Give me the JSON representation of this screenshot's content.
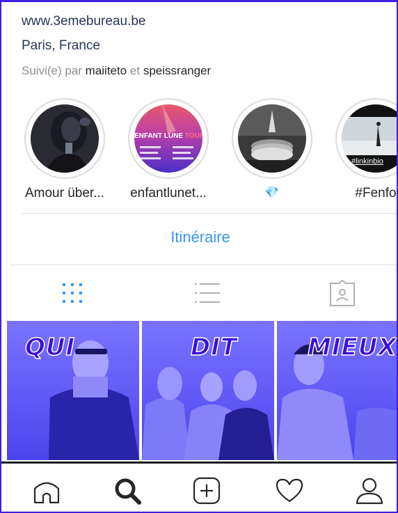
{
  "profile": {
    "website": "www.3emebureau.be",
    "location": "Paris, France",
    "followed_prefix": "Suivi(e) par",
    "followed_user1": "maiiteto",
    "followed_conj": "et",
    "followed_user2": "speissranger"
  },
  "highlights": [
    {
      "label": "Amour über..."
    },
    {
      "label": "enfantlunet..."
    },
    {
      "label": "💎"
    },
    {
      "label": "#Fenfo"
    }
  ],
  "highlight_texts": {
    "enfant_lune": "ENFANT LUNE",
    "tour": "TOUR",
    "linkinbio": "#linkinbio"
  },
  "directions_label": "Itinéraire",
  "view_tabs": [
    "grid-icon",
    "list-icon",
    "tagged-icon"
  ],
  "posts": [
    {
      "word": "QUI"
    },
    {
      "word": "DIT"
    },
    {
      "word": "MIEUX"
    }
  ],
  "nav": [
    "home-icon",
    "search-icon",
    "add-post-icon",
    "heart-icon",
    "profile-icon"
  ],
  "colors": {
    "link_blue": "#3897f0",
    "frame": "#3f1de0",
    "post_overlay": "#5e57f5",
    "post_text": "#3a10d8"
  }
}
